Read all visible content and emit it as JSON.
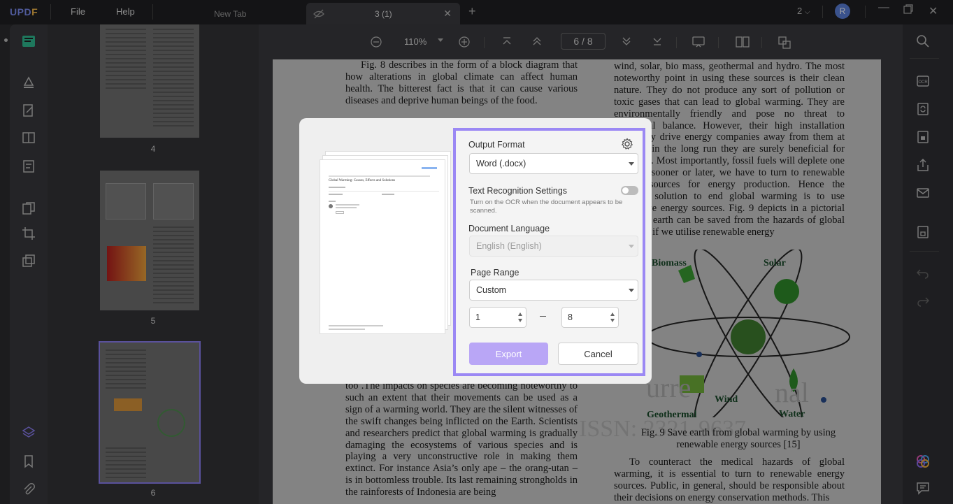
{
  "app": {
    "logo_prefix": "UPD",
    "logo_suffix": "F",
    "menu": [
      "File",
      "Help"
    ],
    "tabs": [
      {
        "label": "New Tab"
      },
      {
        "label": "3 (1)"
      }
    ],
    "window_count": "2",
    "user_initial": "R"
  },
  "toolbar": {
    "zoom": "110%",
    "current_page": "6",
    "page_sep": "/",
    "total_pages": "8"
  },
  "thumbnails": [
    {
      "label": "4"
    },
    {
      "label": "5"
    },
    {
      "label": "6"
    }
  ],
  "document": {
    "left_top": "Fig. 8 describes in the form of a block diagram that how alterations in global climate can affect human health. The bitterest fact is that it can cause various diseases and deprive human beings of the food.",
    "left_bottom": "too .The impacts on species are becoming noteworthy to such an extent that their movements can be used as a sign of a warming world. They are the silent witnesses of the swift changes being inflicted on the Earth. Scientists and researchers predict that global warming is gradually damaging the ecosystems of various species and is playing a very unconstructive role in making them extinct. For instance Asia’s only ape – the orang-utan – is in bottomless trouble. Its last remaining strongholds in the rainforests of Indonesia are being",
    "right_top": "wind, solar, bio mass, geothermal and hydro. The most noteworthy point in using these sources is their clean nature. They do not produce any sort of pollution or toxic gases that can lead to global warming. They are environmentally friendly and pose no threat to ecological balance. However, their high installation costs may drive energy companies away from them at first but in the long run they are surely beneficial for everyone. Most importantly, fossil fuels will deplete one day and sooner or later, we have to turn to renewable energy sources for energy production. Hence the eventual solution to end global warming is to use alternative energy sources. Fig. 9 depicts in a pictorial way that earth can be saved from the hazards of global warming if we utilise renewable energy",
    "figure_labels": {
      "biomass": "Biomass",
      "solar": "Solar",
      "geothermal": "Geothermal",
      "wind": "Wind",
      "water": "Water"
    },
    "watermark_text_1": "urre",
    "watermark_text_2": "nal",
    "watermark_text_3": "ISSN: 2321-9637",
    "caption": "Fig. 9 Save earth from global warming by using renewable energy sources [15]",
    "right_bottom": "To counteract the medical hazards of global warming, it is essential to turn to renewable energy sources. Public, in general, should be responsible about their decisions on energy conservation methods. This"
  },
  "preview": {
    "doc_title": "Global Warming: Causes, Effects and Solutions"
  },
  "dialog": {
    "output_format_label": "Output Format",
    "output_format_value": "Word (.docx)",
    "ocr_label": "Text Recognition Settings",
    "ocr_hint": "Turn on the OCR when the document appears to be scanned.",
    "ocr_enabled": false,
    "language_label": "Document Language",
    "language_value": "English (English)",
    "range_label": "Page Range",
    "range_value": "Custom",
    "range_from": "1",
    "range_to": "8",
    "export_label": "Export",
    "cancel_label": "Cancel",
    "accent": "#9b88f4"
  }
}
